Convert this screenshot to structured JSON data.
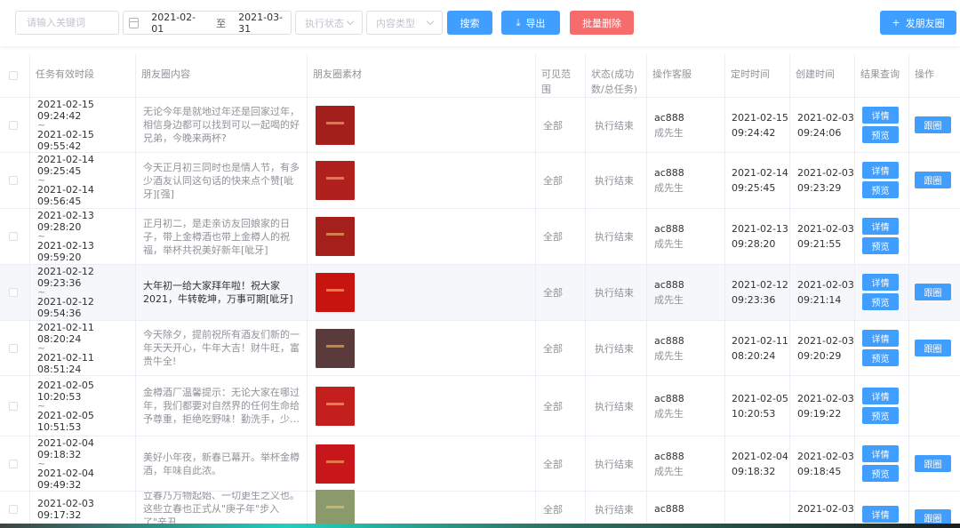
{
  "toolbar": {
    "search_placeholder": "请输入关键词",
    "date_start": "2021-02-01",
    "date_sep": "至",
    "date_end": "2021-03-31",
    "status_placeholder": "执行状态",
    "type_placeholder": "内容类型",
    "search_label": "搜索",
    "export_label": "导出",
    "batch_delete_label": "批量删除",
    "publish_label": "发朋友圈"
  },
  "table": {
    "headers": {
      "time": "任务有效时段",
      "content": "朋友圈内容",
      "media": "朋友圈素材",
      "scope": "可见范围",
      "status": "状态(成功数/总任务)",
      "operator": "操作客服",
      "schedule": "定时时间",
      "created": "创建时间",
      "result": "结果查询",
      "action": "操作"
    },
    "buttons": {
      "detail": "详情",
      "preview": "预览",
      "follow": "跟圈"
    },
    "rows": [
      {
        "start": "2021-02-15 09:24:42",
        "end": "2021-02-15 09:55:42",
        "content": "无论今年是就地过年还是回家过年，相信身边都可以找到可以一起喝的好兄弟，今晚来两杯?",
        "scope": "全部",
        "status": "执行结束",
        "account": "ac888",
        "name": "成先生",
        "sched_date": "2021-02-15",
        "sched_time": "09:24:42",
        "created_date": "2021-02-03",
        "created_time": "09:24:06"
      },
      {
        "start": "2021-02-14 09:25:45",
        "end": "2021-02-14 09:56:45",
        "content": "今天正月初三同时也是情人节，有多少酒友认同这句话的快来点个赞[呲牙][强]",
        "scope": "全部",
        "status": "执行结束",
        "account": "ac888",
        "name": "成先生",
        "sched_date": "2021-02-14",
        "sched_time": "09:25:45",
        "created_date": "2021-02-03",
        "created_time": "09:23:29"
      },
      {
        "start": "2021-02-13 09:28:20",
        "end": "2021-02-13 09:59:20",
        "content": "正月初二，是走亲访友回娘家的日子，带上金樽酒也带上金樽人的祝福，举杯共祝美好新年[呲牙]",
        "scope": "全部",
        "status": "执行结束",
        "account": "ac888",
        "name": "成先生",
        "sched_date": "2021-02-13",
        "sched_time": "09:28:20",
        "created_date": "2021-02-03",
        "created_time": "09:21:55"
      },
      {
        "start": "2021-02-12 09:23:36",
        "end": "2021-02-12 09:54:36",
        "content": "大年初一给大家拜年啦！祝大家2021，牛转乾坤，万事可期[呲牙]",
        "scope": "全部",
        "status": "执行结束",
        "account": "ac888",
        "name": "成先生",
        "sched_date": "2021-02-12",
        "sched_time": "09:23:36",
        "created_date": "2021-02-03",
        "created_time": "09:21:14"
      },
      {
        "start": "2021-02-11 08:20:24",
        "end": "2021-02-11 08:51:24",
        "content": "今天除夕，提前祝所有酒友们新的一年天天开心，牛年大吉！财牛旺，富贵牛全!",
        "scope": "全部",
        "status": "执行结束",
        "account": "ac888",
        "name": "成先生",
        "sched_date": "2021-02-11",
        "sched_time": "08:20:24",
        "created_date": "2021-02-03",
        "created_time": "09:20:29"
      },
      {
        "start": "2021-02-05 10:20:53",
        "end": "2021-02-05 10:51:53",
        "content": "金樽酒厂温馨提示：无论大家在哪过年，我们都要对自然界的任何生命给予尊重，拒绝吃野味！勤洗手，少外出，出门戴口罩，幸福平安过好年！",
        "scope": "全部",
        "status": "执行结束",
        "account": "ac888",
        "name": "成先生",
        "sched_date": "2021-02-05",
        "sched_time": "10:20:53",
        "created_date": "2021-02-03",
        "created_time": "09:19:22"
      },
      {
        "start": "2021-02-04 09:18:32",
        "end": "2021-02-04 09:49:32",
        "content": "美好小年夜，新春已幕开。举杯金樽酒，年味自此浓。",
        "scope": "全部",
        "status": "执行结束",
        "account": "ac888",
        "name": "成先生",
        "sched_date": "2021-02-04",
        "sched_time": "09:18:32",
        "created_date": "2021-02-03",
        "created_time": "09:18:45"
      },
      {
        "start": "2021-02-03 09:17:32",
        "end": "",
        "content": "立春乃万物起始、一切更生之义也。这些立春也正式从\"庚子年\"步入了\"辛丑",
        "scope": "全部",
        "status": "执行结束",
        "account": "ac888",
        "name": "",
        "sched_date": "",
        "sched_time": "",
        "created_date": "2021-02-03",
        "created_time": ""
      }
    ]
  },
  "colors": {
    "primary": "#409eff",
    "danger": "#f56c6c",
    "thumbs": [
      "#a31f1c",
      "#b0201c",
      "#a5201a",
      "#c8140f",
      "#5a3a3a",
      "#c3201d",
      "#c8161a",
      "#8a9a6a"
    ]
  }
}
